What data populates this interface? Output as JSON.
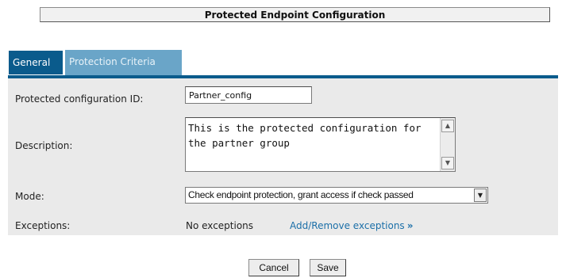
{
  "header": {
    "title": "Protected Endpoint Configuration"
  },
  "tabs": [
    {
      "label": "General",
      "active": true
    },
    {
      "label": "Protection Criteria",
      "active": false
    }
  ],
  "form": {
    "id_label": "Protected configuration ID:",
    "id_value": "Partner_config",
    "description_label": "Description:",
    "description_value": "This is the protected configuration for the partner group",
    "mode_label": "Mode:",
    "mode_value": "Check endpoint protection, grant access if check passed",
    "exceptions_label": "Exceptions:",
    "exceptions_value": "No exceptions",
    "exceptions_link": "Add/Remove exceptions"
  },
  "buttons": {
    "cancel": "Cancel",
    "save": "Save"
  },
  "colors": {
    "tab_active": "#0a5b8c",
    "tab_inactive": "#6aa5c8",
    "panel": "#eaeaea",
    "link": "#1b6fa8"
  },
  "icons": {
    "scroll_up": "scroll-up-arrow-icon",
    "scroll_down": "scroll-down-arrow-icon",
    "dropdown": "chevron-down-icon",
    "link_chevron": "double-chevron-right-icon"
  }
}
